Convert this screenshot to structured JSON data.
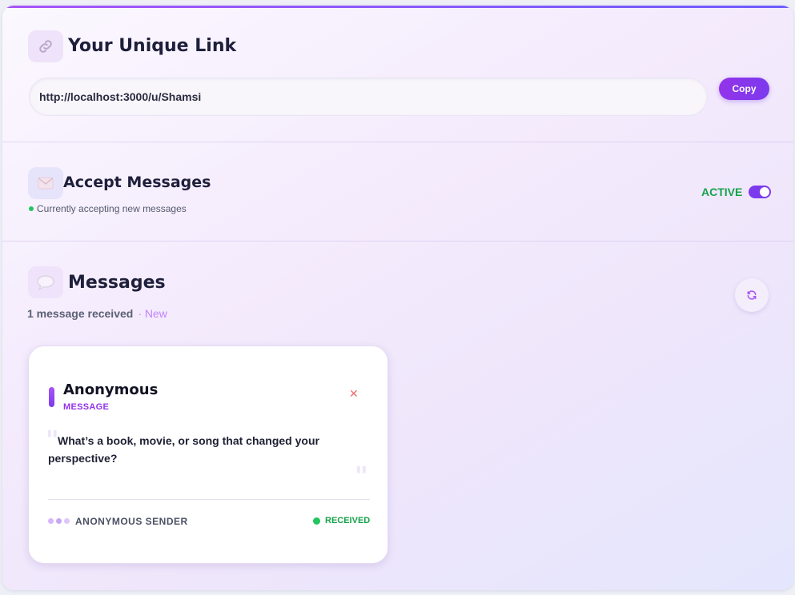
{
  "link_section": {
    "icon": "link-icon",
    "title": "Your Unique Link",
    "url": "http://localhost:3000/u/Shamsi",
    "copy_label": "Copy"
  },
  "accept_section": {
    "icon": "envelope-icon",
    "title": "Accept Messages",
    "status_text": "Currently accepting new messages",
    "toggle_label": "ACTIVE",
    "toggle_on": true
  },
  "messages_section": {
    "icon": "speech-bubble-icon",
    "title": "Messages",
    "count_text": "1 message received",
    "new_text": "· New",
    "messages": [
      {
        "sender": "Anonymous",
        "tag": "MESSAGE",
        "content": "What’s a book, movie, or song that changed your perspective?",
        "footer_label": "ANONYMOUS SENDER",
        "status": "RECEIVED"
      }
    ]
  },
  "colors": {
    "accent": "#7c3aed",
    "active_green": "#16a34a"
  }
}
